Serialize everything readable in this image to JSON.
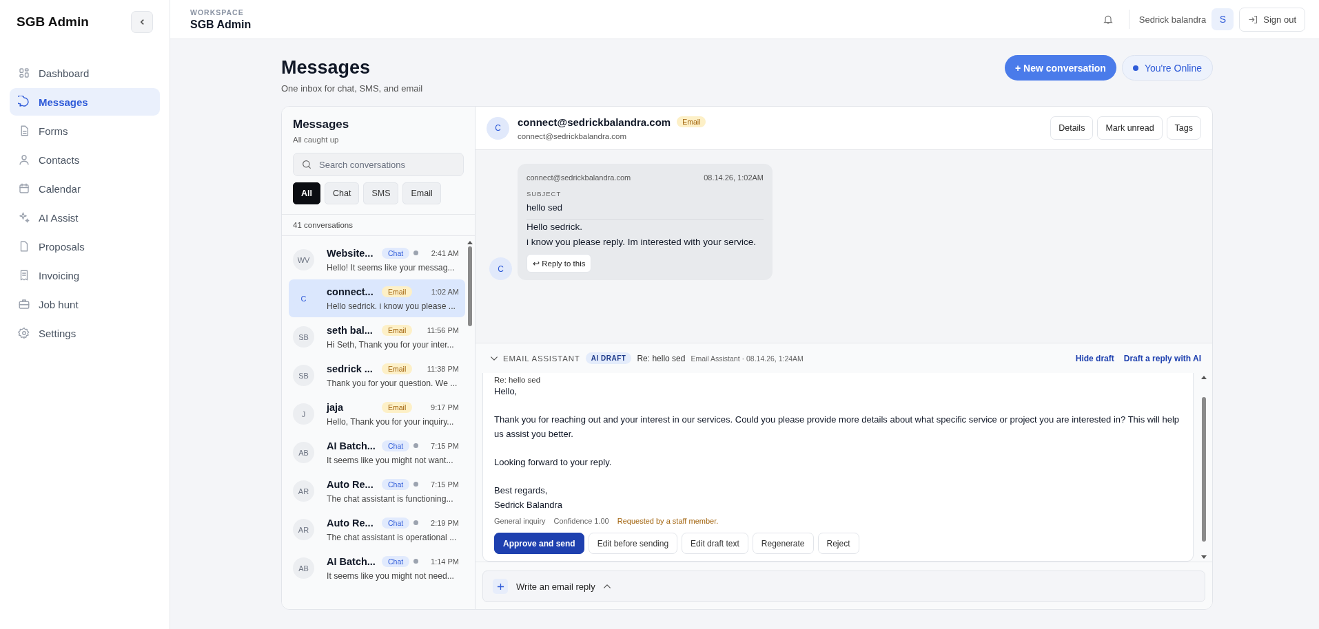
{
  "sidebar": {
    "title": "SGB Admin",
    "items": [
      {
        "label": "Dashboard",
        "selected": false
      },
      {
        "label": "Messages",
        "selected": true
      },
      {
        "label": "Forms",
        "selected": false
      },
      {
        "label": "Contacts",
        "selected": false
      },
      {
        "label": "Calendar",
        "selected": false
      },
      {
        "label": "AI Assist",
        "selected": false
      },
      {
        "label": "Proposals",
        "selected": false
      },
      {
        "label": "Invoicing",
        "selected": false
      },
      {
        "label": "Job hunt",
        "selected": false
      },
      {
        "label": "Settings",
        "selected": false
      }
    ]
  },
  "header": {
    "eyebrow": "WORKSPACE",
    "title": "SGB Admin",
    "user_name": "Sedrick balandra",
    "avatar": "S",
    "sign_out": "Sign out"
  },
  "page": {
    "title": "Messages",
    "subtitle": "One inbox for chat, SMS, and email",
    "new_button": "+ New conversation",
    "status": "You're Online"
  },
  "inbox": {
    "title": "Messages",
    "subtitle": "All caught up",
    "search": {
      "placeholder": "Search conversations"
    },
    "filters": [
      {
        "label": "All",
        "selected": true
      },
      {
        "label": "Chat",
        "selected": false
      },
      {
        "label": "SMS",
        "selected": false
      },
      {
        "label": "Email",
        "selected": false
      }
    ],
    "count": "41 conversations",
    "conversations": [
      {
        "avatar": "WV",
        "name": "Website...",
        "channel": "Chat",
        "kind": "chat",
        "dot": true,
        "time": "2:41 AM",
        "preview": "Hello! It seems like your messag...",
        "selected": false
      },
      {
        "avatar": "C",
        "name": "connect...",
        "channel": "Email",
        "kind": "email",
        "dot": false,
        "time": "1:02 AM",
        "preview": "Hello sedrick. i know you please ...",
        "selected": true
      },
      {
        "avatar": "SB",
        "name": "seth bal...",
        "channel": "Email",
        "kind": "email",
        "dot": false,
        "time": "11:56 PM",
        "preview": "Hi Seth, Thank you for your inter...",
        "selected": false
      },
      {
        "avatar": "SB",
        "name": "sedrick ...",
        "channel": "Email",
        "kind": "email",
        "dot": false,
        "time": "11:38 PM",
        "preview": "Thank you for your question. We ...",
        "selected": false
      },
      {
        "avatar": "J",
        "name": "jaja",
        "channel": "Email",
        "kind": "email",
        "dot": false,
        "time": "9:17 PM",
        "preview": "Hello, Thank you for your inquiry...",
        "selected": false
      },
      {
        "avatar": "AB",
        "name": "AI Batch...",
        "channel": "Chat",
        "kind": "chat",
        "dot": true,
        "time": "7:15 PM",
        "preview": "It seems like you might not want...",
        "selected": false
      },
      {
        "avatar": "AR",
        "name": "Auto Re...",
        "channel": "Chat",
        "kind": "chat",
        "dot": true,
        "time": "7:15 PM",
        "preview": "The chat assistant is functioning...",
        "selected": false
      },
      {
        "avatar": "AR",
        "name": "Auto Re...",
        "channel": "Chat",
        "kind": "chat",
        "dot": true,
        "time": "2:19 PM",
        "preview": "The chat assistant is operational ...",
        "selected": false
      },
      {
        "avatar": "AB",
        "name": "AI Batch...",
        "channel": "Chat",
        "kind": "chat",
        "dot": true,
        "time": "1:14 PM",
        "preview": "It seems like you might not need...",
        "selected": false
      }
    ]
  },
  "thread": {
    "avatar": "C",
    "name": "connect@sedrickbalandra.com",
    "channel": "Email",
    "kind": "email",
    "email": "connect@sedrickbalandra.com",
    "actions": [
      "Details",
      "Mark unread",
      "Tags"
    ],
    "messages": [
      {
        "avatar": "C",
        "from": "connect@sedrickbalandra.com",
        "time": "08.14.26, 1:02AM",
        "subject_label": "SUBJECT",
        "subject": "hello sed",
        "body": [
          "Hello sedrick.",
          "i know you please reply. Im interested with your service."
        ],
        "reply": "↩ Reply to this"
      }
    ]
  },
  "draft": {
    "label": "EMAIL ASSISTANT",
    "badge": "AI DRAFT",
    "subject": "Re: hello sed",
    "meta": "Email Assistant · 08.14.26, 1:24AM",
    "links": [
      "Hide draft",
      "Draft a reply with AI"
    ],
    "subject_line": "Re: hello sed",
    "paragraphs": [
      "Hello,",
      "Thank you for reaching out and your interest in our services. Could you please provide more details about what specific service or project you are interested in? This will help us assist you better.",
      "Looking forward to your reply.",
      "Best regards,\nSedrick Balandra"
    ],
    "category": "General inquiry",
    "confidence": "Confidence 1.00",
    "note": "Requested by a staff member.",
    "actions": [
      {
        "label": "Approve and send",
        "kind": "primary"
      },
      {
        "label": "Edit before sending",
        "kind": "secondary"
      },
      {
        "label": "Edit draft text",
        "kind": "secondary"
      },
      {
        "label": "Regenerate",
        "kind": "secondary"
      },
      {
        "label": "Reject",
        "kind": "secondary"
      }
    ]
  },
  "composer": {
    "label": "Write an email reply"
  }
}
